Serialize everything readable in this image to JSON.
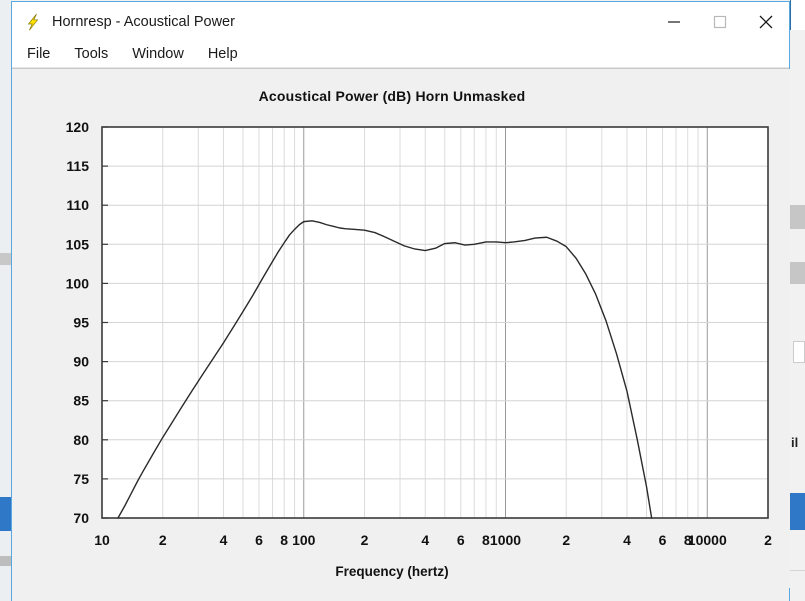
{
  "window": {
    "title": "Hornresp - Acoustical Power",
    "icon": "lightning-bolt-icon",
    "controls": {
      "minimize": "minimize-icon",
      "maximize": "maximize-icon",
      "close": "close-icon"
    }
  },
  "menubar": {
    "items": [
      {
        "label": "File"
      },
      {
        "label": "Tools"
      },
      {
        "label": "Window"
      },
      {
        "label": "Help"
      }
    ]
  },
  "background": {
    "right_label": "il"
  },
  "chart_data": {
    "type": "line",
    "title": "Acoustical Power (dB)   Horn   Unmasked",
    "xlabel": "Frequency (hertz)",
    "ylabel": "",
    "xscale": "log",
    "xlim": [
      10,
      20000
    ],
    "ylim": [
      70,
      120
    ],
    "grid": true,
    "legend": "none",
    "ytick_labels": [
      "120",
      "115",
      "110",
      "105",
      "100",
      "95",
      "90",
      "85",
      "80",
      "75",
      "70"
    ],
    "ytick_values": [
      120,
      115,
      110,
      105,
      100,
      95,
      90,
      85,
      80,
      75,
      70
    ],
    "xtick_labels": [
      "10",
      "2",
      "4",
      "6",
      "8",
      "100",
      "2",
      "4",
      "6",
      "8",
      "1000",
      "2",
      "4",
      "6",
      "8",
      "10000",
      "2"
    ],
    "xtick_values": [
      10,
      20,
      40,
      60,
      80,
      100,
      200,
      400,
      600,
      800,
      1000,
      2000,
      4000,
      6000,
      8000,
      10000,
      20000
    ],
    "line_color": "#2a2a2a",
    "series": [
      {
        "name": "Acoustical Power",
        "x": [
          12.0,
          13.0,
          14.0,
          15.0,
          16.0,
          18.0,
          20.0,
          22.0,
          25.0,
          28.0,
          32.0,
          36.0,
          40.0,
          45.0,
          50.0,
          56.0,
          63.0,
          70.0,
          75.0,
          80.0,
          85.0,
          90.0,
          95.0,
          100.0,
          110.0,
          120.0,
          130.0,
          140.0,
          150.0,
          160.0,
          180.0,
          200.0,
          225.0,
          250.0,
          280.0,
          315.0,
          355.0,
          400.0,
          450.0,
          500.0,
          560.0,
          630.0,
          700.0,
          800.0,
          900.0,
          1000.0,
          1100.0,
          1250.0,
          1400.0,
          1600.0,
          1800.0,
          2000.0,
          2240.0,
          2500.0,
          2800.0,
          3150.0,
          3550.0,
          4000.0
        ],
        "y": [
          70.0,
          71.6,
          73.2,
          74.7,
          76.0,
          78.3,
          80.3,
          82.0,
          84.3,
          86.3,
          88.6,
          90.6,
          92.4,
          94.5,
          96.4,
          98.5,
          100.8,
          102.8,
          104.1,
          105.2,
          106.2,
          106.9,
          107.5,
          107.9,
          108.0,
          107.8,
          107.5,
          107.3,
          107.1,
          107.0,
          106.9,
          106.8,
          106.5,
          106.0,
          105.4,
          104.8,
          104.4,
          104.2,
          104.5,
          105.1,
          105.2,
          104.9,
          105.0,
          105.3,
          105.3,
          105.2,
          105.3,
          105.5,
          105.8,
          105.9,
          105.4,
          104.7,
          103.2,
          101.2,
          98.6,
          95.2,
          91.0,
          86.2
        ],
        "y_tail_x": [
          4000.0,
          4500.0,
          5000.0,
          5300.0
        ],
        "y_tail_y": [
          86.2,
          80.0,
          74.0,
          70.0
        ]
      }
    ]
  }
}
